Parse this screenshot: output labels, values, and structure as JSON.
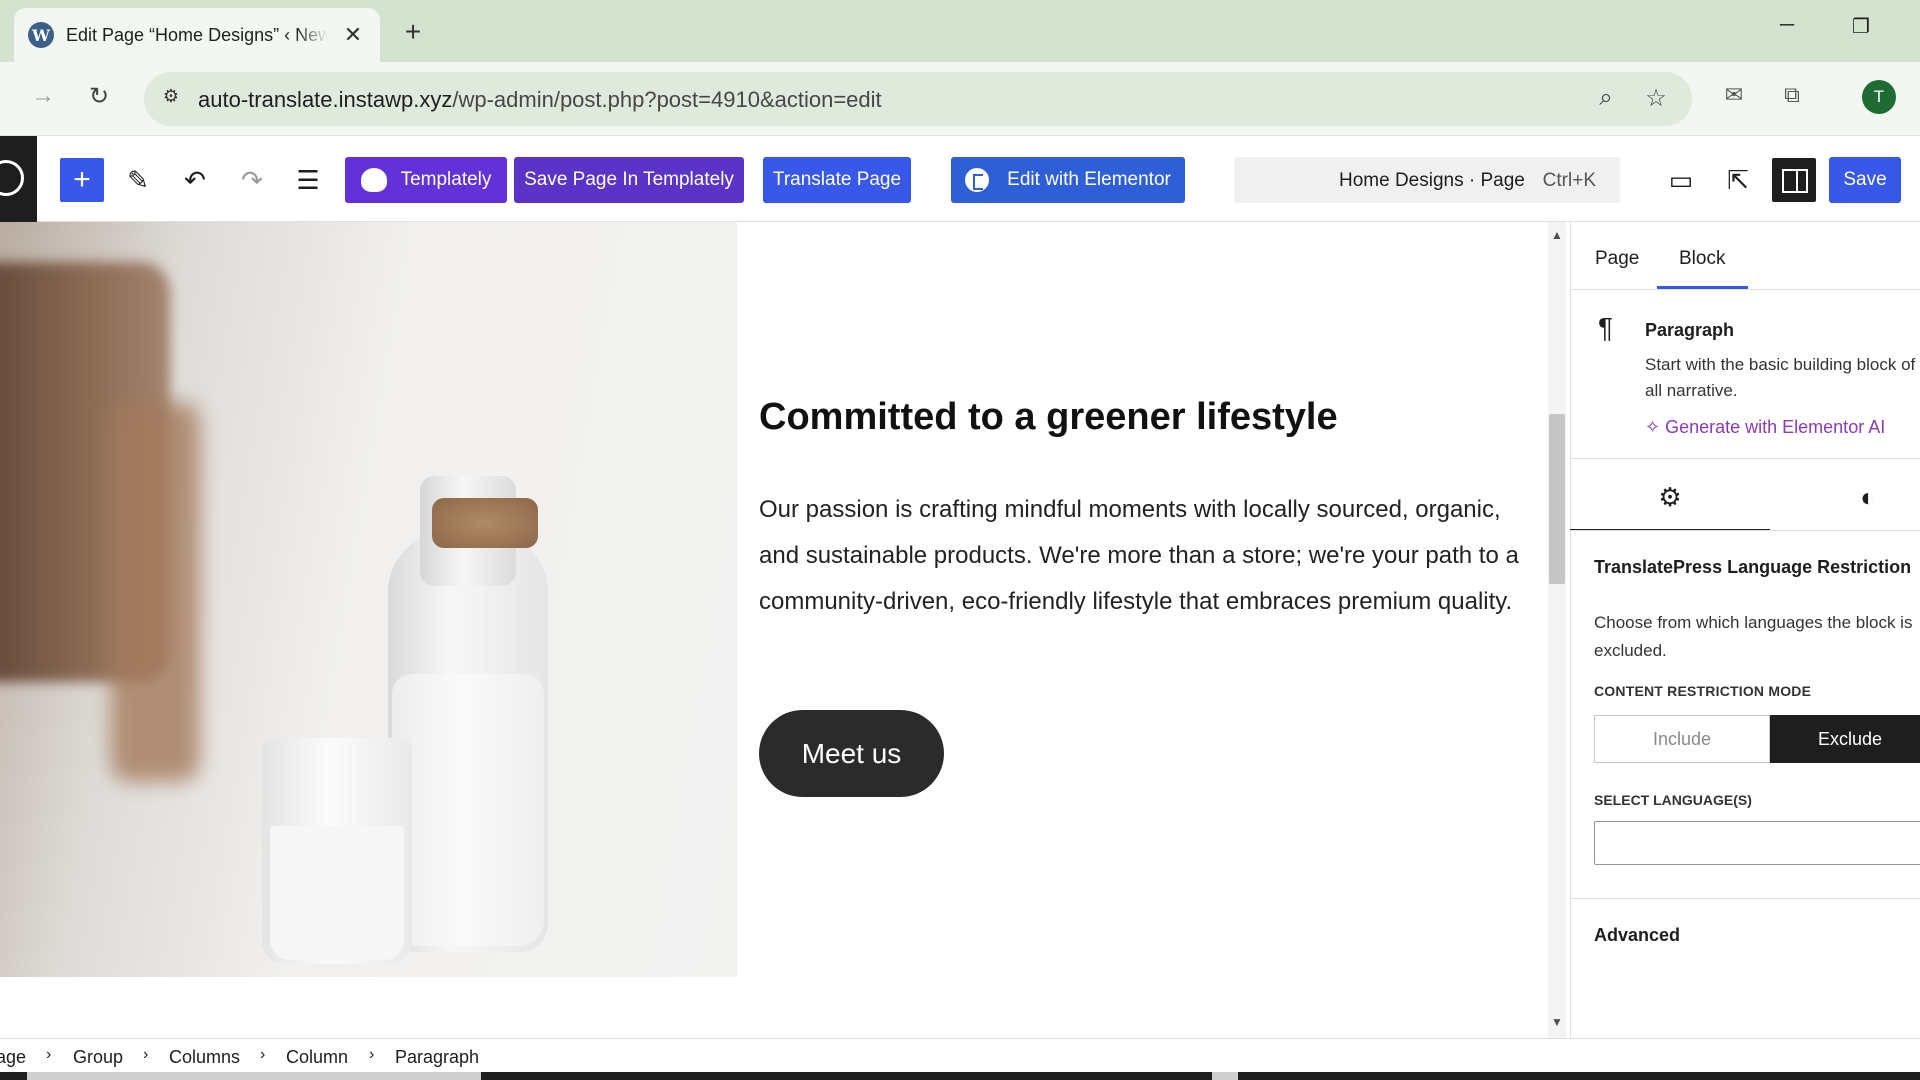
{
  "browser": {
    "tab_title": "Edit Page “Home Designs” ‹ New",
    "tab_icon": "wordpress-icon",
    "url_host": "auto-translate.instawp.xyz",
    "url_path": "/wp-admin/post.php?post=4910&action=edit",
    "avatar_letter": "T"
  },
  "toolbar": {
    "templately_label": "Templately",
    "save_templately_label": "Save Page In Templately",
    "translate_label": "Translate Page",
    "elementor_label": "Edit with Elementor",
    "command_title": "Home Designs · Page",
    "command_shortcut": "Ctrl+K",
    "save_label": "Save"
  },
  "canvas": {
    "heading": "Committed to a greener lifestyle",
    "paragraph": "Our passion is crafting mindful moments with locally sourced, organic, and sustainable products. We're more than a store; we're your path to a community-driven, eco-friendly lifestyle that embraces premium quality.",
    "button_label": "Meet us"
  },
  "sidebar": {
    "tabs": [
      "Page",
      "Block"
    ],
    "active_tab": "Block",
    "block_name": "Paragraph",
    "block_description": "Start with the basic building block of all narrative.",
    "ai_link": "Generate with Elementor AI",
    "translatepress_title": "TranslatePress Language Restriction",
    "translatepress_desc": "Choose from which languages the block is excluded.",
    "restriction_mode_label": "CONTENT RESTRICTION MODE",
    "mode_include": "Include",
    "mode_exclude": "Exclude",
    "mode_selected": "Exclude",
    "select_languages_label": "SELECT LANGUAGE(S)",
    "select_languages_value": "",
    "advanced_label": "Advanced"
  },
  "breadcrumb": [
    "Page",
    "Group",
    "Columns",
    "Column",
    "Paragraph"
  ],
  "colors": {
    "wp_blue": "#3858e9",
    "templately_purple": "#6232d8",
    "browser_frame": "#d3e3cf",
    "ai_purple": "#8a3ab9"
  }
}
